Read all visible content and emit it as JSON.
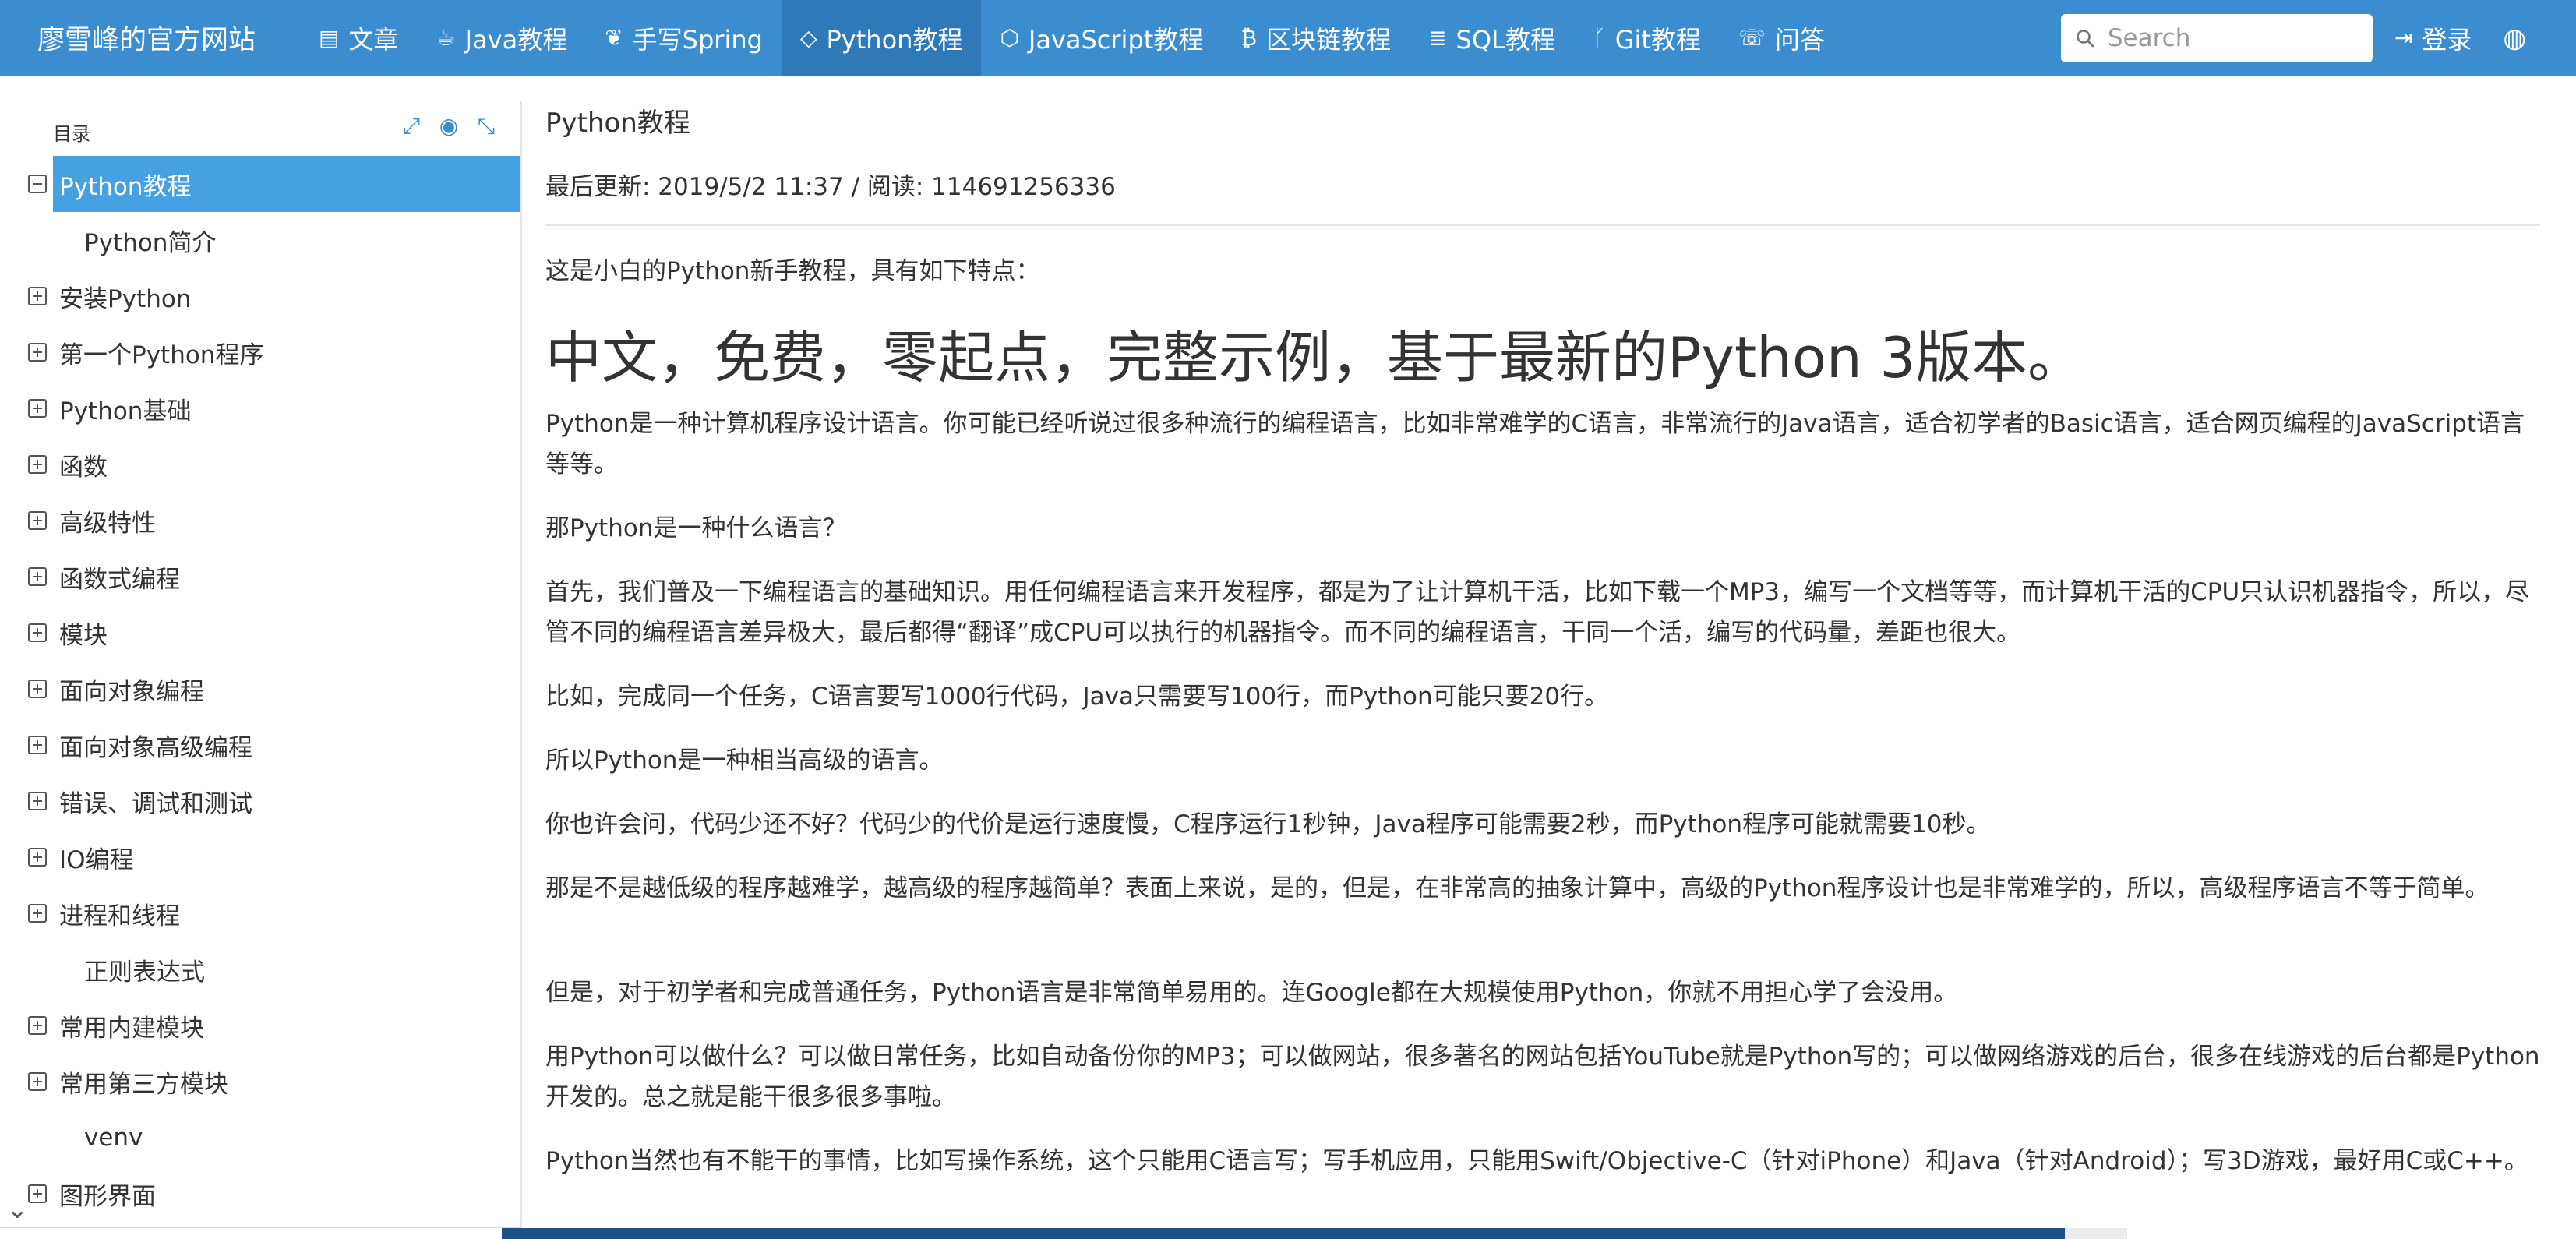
{
  "navbar": {
    "brand": "廖雪峰的官方网站",
    "items": [
      {
        "label": "文章",
        "icon": "newspaper-icon",
        "glyph": "▤"
      },
      {
        "label": "Java教程",
        "icon": "coffee-icon",
        "glyph": "☕"
      },
      {
        "label": "手写Spring",
        "icon": "leaf-icon",
        "glyph": "❦"
      },
      {
        "label": "Python教程",
        "icon": "code-icon",
        "glyph": "◇",
        "active": true
      },
      {
        "label": "JavaScript教程",
        "icon": "html5-icon",
        "glyph": "⬡"
      },
      {
        "label": "区块链教程",
        "icon": "bitcoin-icon",
        "glyph": "₿"
      },
      {
        "label": "SQL教程",
        "icon": "database-icon",
        "glyph": "≣"
      },
      {
        "label": "Git教程",
        "icon": "git-branch-icon",
        "glyph": "ᚴ"
      },
      {
        "label": "问答",
        "icon": "comments-icon",
        "glyph": "☏"
      }
    ],
    "search_placeholder": "Search",
    "login_label": "登录",
    "login_icon": "sign-in-icon",
    "globe_icon": "globe-icon",
    "accent_color": "#3b8dcf"
  },
  "sidebar": {
    "title": "目录",
    "tools": [
      {
        "icon": "expand-icon",
        "glyph": "⤢"
      },
      {
        "icon": "target-icon",
        "glyph": "◉"
      },
      {
        "icon": "compress-icon",
        "glyph": "⤡"
      }
    ],
    "items": [
      {
        "label": "Python教程",
        "level": "root",
        "toggle": "minus",
        "active": true
      },
      {
        "label": "Python简介",
        "level": "sub",
        "toggle": "none"
      },
      {
        "label": "安装Python",
        "level": "top",
        "toggle": "plus"
      },
      {
        "label": "第一个Python程序",
        "level": "top",
        "toggle": "plus"
      },
      {
        "label": "Python基础",
        "level": "top",
        "toggle": "plus"
      },
      {
        "label": "函数",
        "level": "top",
        "toggle": "plus"
      },
      {
        "label": "高级特性",
        "level": "top",
        "toggle": "plus"
      },
      {
        "label": "函数式编程",
        "level": "top",
        "toggle": "plus"
      },
      {
        "label": "模块",
        "level": "top",
        "toggle": "plus"
      },
      {
        "label": "面向对象编程",
        "level": "top",
        "toggle": "plus"
      },
      {
        "label": "面向对象高级编程",
        "level": "top",
        "toggle": "plus"
      },
      {
        "label": "错误、调试和测试",
        "level": "top",
        "toggle": "plus"
      },
      {
        "label": "IO编程",
        "level": "top",
        "toggle": "plus"
      },
      {
        "label": "进程和线程",
        "level": "top",
        "toggle": "plus"
      },
      {
        "label": "正则表达式",
        "level": "sub",
        "toggle": "none"
      },
      {
        "label": "常用内建模块",
        "level": "top",
        "toggle": "plus"
      },
      {
        "label": "常用第三方模块",
        "level": "top",
        "toggle": "plus"
      },
      {
        "label": "venv",
        "level": "sub",
        "toggle": "none"
      },
      {
        "label": "图形界面",
        "level": "top",
        "toggle": "plus"
      }
    ],
    "active_color": "#45a1e2",
    "bottom_icon": "chevron-down-icon"
  },
  "main": {
    "title": "Python教程",
    "meta": "最后更新: 2019/5/2 11:37 / 阅读: 114691256336",
    "intro": "这是小白的Python新手教程，具有如下特点：",
    "headline": "中文，免费，零起点，完整示例，基于最新的Python 3版本。",
    "paragraphs": [
      "Python是一种计算机程序设计语言。你可能已经听说过很多种流行的编程语言，比如非常难学的C语言，非常流行的Java语言，适合初学者的Basic语言，适合网页编程的JavaScript语言等等。",
      "那Python是一种什么语言？",
      "首先，我们普及一下编程语言的基础知识。用任何编程语言来开发程序，都是为了让计算机干活，比如下载一个MP3，编写一个文档等等，而计算机干活的CPU只认识机器指令，所以，尽管不同的编程语言差异极大，最后都得“翻译”成CPU可以执行的机器指令。而不同的编程语言，干同一个活，编写的代码量，差距也很大。",
      "比如，完成同一个任务，C语言要写1000行代码，Java只需要写100行，而Python可能只要20行。",
      "所以Python是一种相当高级的语言。",
      "你也许会问，代码少还不好？代码少的代价是运行速度慢，C程序运行1秒钟，Java程序可能需要2秒，而Python程序可能就需要10秒。",
      "那是不是越低级的程序越难学，越高级的程序越简单？表面上来说，是的，但是，在非常高的抽象计算中，高级的Python程序设计也是非常难学的，所以，高级程序语言不等于简单。",
      "但是，对于初学者和完成普通任务，Python语言是非常简单易用的。连Google都在大规模使用Python，你就不用担心学了会没用。",
      "用Python可以做什么？可以做日常任务，比如自动备份你的MP3；可以做网站，很多著名的网站包括YouTube就是Python写的；可以做网络游戏的后台，很多在线游戏的后台都是Python开发的。总之就是能干很多很多事啦。",
      "Python当然也有不能干的事情，比如写操作系统，这个只能用C语言写；写手机应用，只能用Swift/Objective-C（针对iPhone）和Java（针对Android）；写3D游戏，最好用C或C++。"
    ]
  }
}
